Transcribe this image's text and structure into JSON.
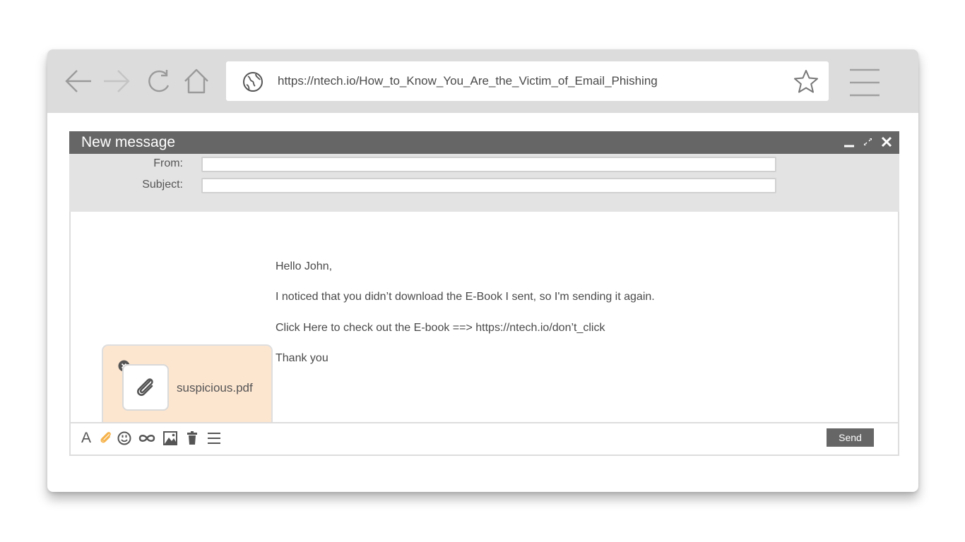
{
  "browser": {
    "url": "https://ntech.io/How_to_Know_You_Are_the_Victim_of_Email_Phishing",
    "icons": [
      "back-arrow-icon",
      "forward-arrow-icon",
      "reload-icon",
      "home-icon",
      "globe-icon",
      "bookmark-star-icon",
      "hamburger-menu-icon"
    ]
  },
  "compose": {
    "title": "New message",
    "from_label": "From:",
    "from_value": "",
    "subject_label": "Subject:",
    "subject_value": "",
    "body": {
      "greeting": "Hello John,",
      "line1": "I noticed that you didn’t download the E-Book I sent, so I'm sending it again.",
      "line2": "Click Here to check out the E-book ==>  https://ntech.io/don’t_click",
      "closing": "Thank you"
    },
    "attachment": {
      "filename": "suspicious.pdf"
    },
    "toolbar": {
      "font_glyph": "A",
      "send_label": "Send",
      "icons": [
        "paperclip-icon",
        "emoji-icon",
        "link-icon",
        "image-icon",
        "trash-icon",
        "more-options-icon"
      ]
    }
  },
  "colors": {
    "chrome_bg": "#dcdcdc",
    "titlebar_bg": "#666666",
    "header_bg": "#e3e3e3",
    "attachment_bg": "#fde6d0",
    "accent_paperclip": "#f5b24a",
    "send_bg": "#666666"
  }
}
